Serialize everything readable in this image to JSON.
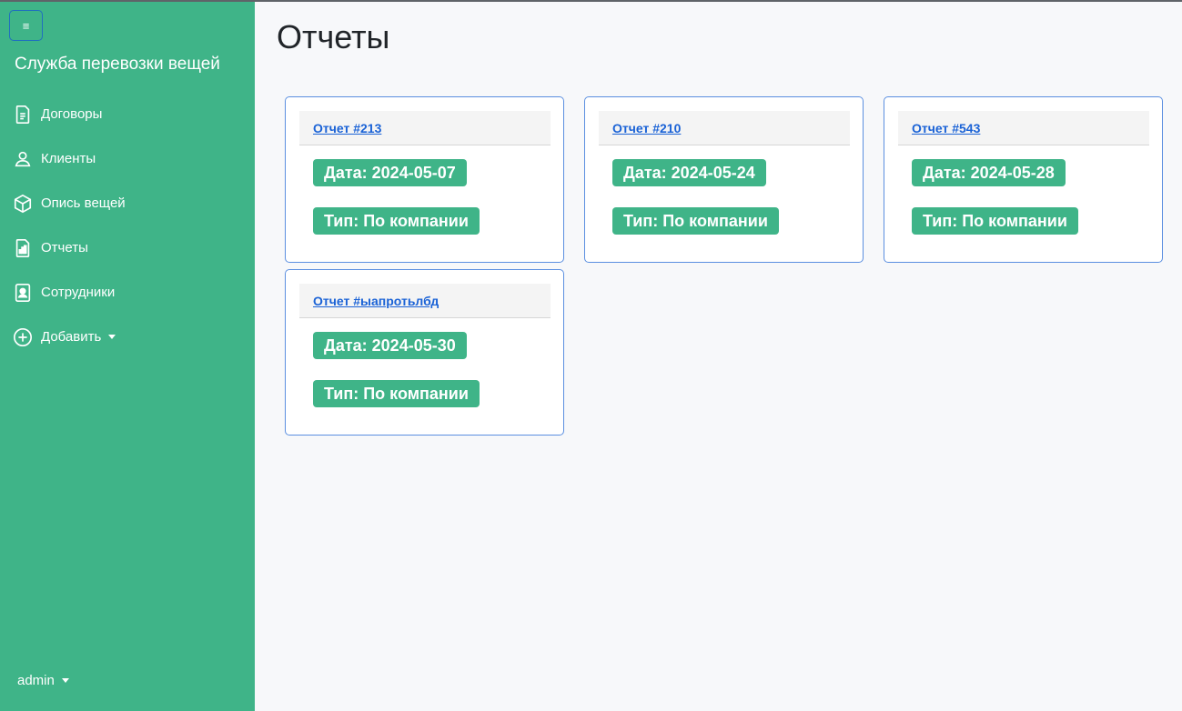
{
  "sidebar": {
    "toggle_icon": "≡",
    "brand": "Служба перевозки вещей",
    "items": [
      {
        "label": "Договоры",
        "icon": "document-icon"
      },
      {
        "label": "Клиенты",
        "icon": "user-icon"
      },
      {
        "label": "Опись вещей",
        "icon": "box-icon"
      },
      {
        "label": "Отчеты",
        "icon": "report-icon"
      },
      {
        "label": "Сотрудники",
        "icon": "employee-badge-icon"
      },
      {
        "label": "Добавить",
        "icon": "plus-circle-icon"
      }
    ],
    "user": "admin"
  },
  "main": {
    "title": "Отчеты",
    "reports": [
      {
        "title": "Отчет #213",
        "date": "Дата: 2024-05-07",
        "type": "Тип: По компании"
      },
      {
        "title": "Отчет #210",
        "date": "Дата: 2024-05-24",
        "type": "Тип: По компании"
      },
      {
        "title": "Отчет #543",
        "date": "Дата: 2024-05-28",
        "type": "Тип: По компании"
      },
      {
        "title": "Отчет #ыапротьлбд",
        "date": "Дата: 2024-05-30",
        "type": "Тип: По компании"
      }
    ]
  },
  "colors": {
    "sidebar_bg": "#3fb488",
    "badge_bg": "#3fb488",
    "card_border": "#5b8fe0",
    "link": "#1a62d6"
  }
}
